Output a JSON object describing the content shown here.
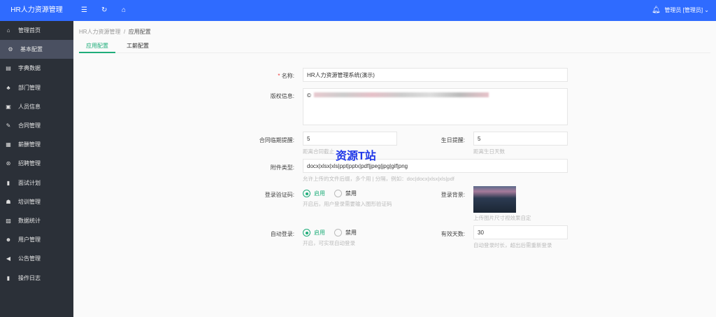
{
  "header": {
    "title": "HR人力资源管理",
    "user": "管理员 [管理员]"
  },
  "sidebar": {
    "items": [
      {
        "label": "管理首页",
        "icon": "home-icon",
        "glyph": "⌂"
      },
      {
        "label": "基本配置",
        "icon": "gear-icon",
        "glyph": "⚙"
      },
      {
        "label": "字典数据",
        "icon": "book-icon",
        "glyph": "▤"
      },
      {
        "label": "部门管理",
        "icon": "sitemap-icon",
        "glyph": "♣"
      },
      {
        "label": "人员信息",
        "icon": "id-card-icon",
        "glyph": "▣"
      },
      {
        "label": "合同管理",
        "icon": "contract-icon",
        "glyph": "✎"
      },
      {
        "label": "薪酬管理",
        "icon": "salary-icon",
        "glyph": "▦"
      },
      {
        "label": "招聘管理",
        "icon": "handshake-icon",
        "glyph": "⊛"
      },
      {
        "label": "面试计划",
        "icon": "clipboard-icon",
        "glyph": "▮"
      },
      {
        "label": "培训管理",
        "icon": "graduation-icon",
        "glyph": "☗"
      },
      {
        "label": "数据统计",
        "icon": "chart-icon",
        "glyph": "▨"
      },
      {
        "label": "用户管理",
        "icon": "user-icon",
        "glyph": "☻"
      },
      {
        "label": "公告管理",
        "icon": "megaphone-icon",
        "glyph": "◀"
      },
      {
        "label": "操作日志",
        "icon": "log-icon",
        "glyph": "▮"
      }
    ]
  },
  "breadcrumb": {
    "root": "HR人力资源管理",
    "sep": "/",
    "current": "应用配置"
  },
  "tabs": [
    "应用配置",
    "工薪配置"
  ],
  "form": {
    "name_label": "名称:",
    "name_value": "HR人力资源管理系统(演示)",
    "copyright_label": "版权信息:",
    "copyright_prefix": "©",
    "contract_label": "合同临期提醒:",
    "contract_value": "5",
    "contract_hint": "距离合同截止",
    "birthday_label": "生日提醒:",
    "birthday_value": "5",
    "birthday_hint": "距离生日天数",
    "attach_label": "附件类型:",
    "attach_value": "docx|xlsx|xls|ppt|pptx|pdf|jpeg|jpg|gif|png",
    "attach_hint": "允许上传的文件后缀，多个用 | 分隔，例如：doc|docx|xlsx|xls|pdf",
    "captcha_label": "登录验证码:",
    "enable": "启用",
    "disable": "禁用",
    "captcha_hint": "开启后，用户登录需要输入图形验证码",
    "bg_label": "登录背景:",
    "bg_hint": "上传图片尺寸视效果自定",
    "auto_label": "自动登录:",
    "auto_hint": "开启，可实现自动登录",
    "days_label": "有效天数:",
    "days_value": "30",
    "days_hint": "自动登录时长，超出后需重新登录"
  },
  "watermark": "资源T站"
}
